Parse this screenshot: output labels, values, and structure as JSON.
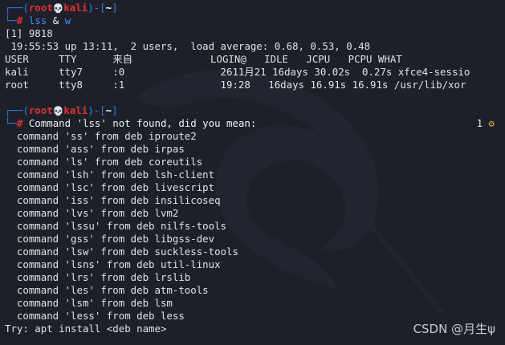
{
  "prompt1": {
    "user": "root",
    "skull": "💀",
    "host": "kali",
    "cwd": "~",
    "hash": "#",
    "command": "lss",
    "op": "&",
    "arg": "w"
  },
  "job_line": "[1] 9818",
  "w_output": {
    "uptime": " 19:55:53 up 13:11,  2 users,  load average: 0.68, 0.53, 0.48",
    "header": "USER     TTY      来自             LOGIN@   IDLE   JCPU   PCPU WHAT",
    "rows": [
      "kali     tty7     :0                2611月21 16days 30.02s  0.27s xfce4-sessio",
      "root     tty8     :1                19:28   16days 16.91s 16.91s /usr/lib/xor"
    ]
  },
  "prompt2": {
    "user": "root",
    "skull": "💀",
    "host": "kali",
    "cwd": "~",
    "hash": "#",
    "message": " Command 'lss' not found, did you mean:",
    "badge_count": "1",
    "badge_icon": "⚙"
  },
  "suggestions": [
    "  command 'ss' from deb iproute2",
    "  command 'ass' from deb irpas",
    "  command 'ls' from deb coreutils",
    "  command 'lsh' from deb lsh-client",
    "  command 'lsc' from deb livescript",
    "  command 'iss' from deb insilicoseq",
    "  command 'lvs' from deb lvm2",
    "  command 'lssu' from deb nilfs-tools",
    "  command 'gss' from deb libgss-dev",
    "  command 'lsw' from deb suckless-tools",
    "  command 'lsns' from deb util-linux",
    "  command 'lrs' from deb lrslib",
    "  command 'les' from deb atm-tools",
    "  command 'lsm' from deb lsm",
    "  command 'less' from deb less"
  ],
  "try_line": "Try: apt install <deb name>",
  "watermark": "CSDN @月生ψ",
  "colors": {
    "background": "#1e2029",
    "prompt_frame": "#2f7be6",
    "user_host": "#e03131",
    "command": "#3fc04f"
  }
}
